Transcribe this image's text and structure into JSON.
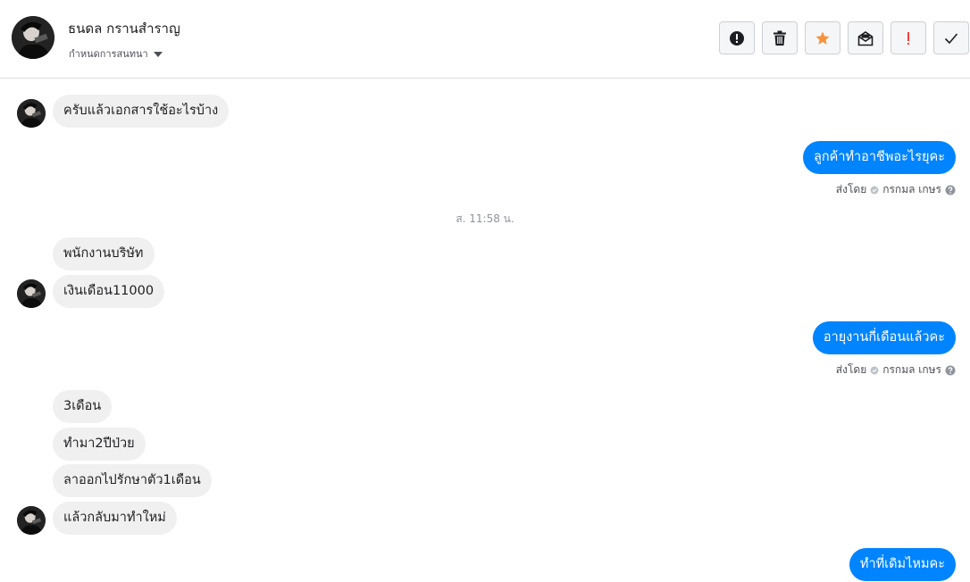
{
  "header": {
    "contact_name": "ธนดล กรานสำราญ",
    "conversation_settings": "กำหนดการสนทนา",
    "toolbar": [
      {
        "name": "report-spam-button",
        "icon": "exclamation-circle-icon"
      },
      {
        "name": "delete-button",
        "icon": "trash-icon"
      },
      {
        "name": "star-button",
        "icon": "star-icon"
      },
      {
        "name": "mark-unread-button",
        "icon": "envelope-icon"
      },
      {
        "name": "follow-up-button",
        "icon": "exclamation-icon"
      },
      {
        "name": "mark-done-button",
        "icon": "check-icon"
      }
    ]
  },
  "colors": {
    "outgoing_bubble": "#0084ff",
    "incoming_bubble": "#f1f0f0",
    "star": "#f7923b",
    "follow_up": "#fa3e3e"
  },
  "messages": {
    "m1": "ครับแล้วเอกสารใช้อะไรบ้าง",
    "m2": "ลูกค้าทำอาชีพอะไรยุคะ",
    "sent_by_1": "ส่งโดย",
    "sender_1": "กรกมล เกษร",
    "time_1": "ส. 11:58 น.",
    "m3": "พนักงานบริษัท",
    "m4": "เงินเดือน11000",
    "m5": "อายุงานกี่เดือนแล้วคะ",
    "sent_by_2": "ส่งโดย",
    "sender_2": "กรกมล เกษร",
    "m6": "3เดือน",
    "m7": "ทำมา2ปีป่วย",
    "m8": "ลาออกไปรักษาตัว1เดือน",
    "m9": "แล้วกลับมาทำใหม่",
    "m10": "ทำที่เดิมไหมคะ"
  }
}
